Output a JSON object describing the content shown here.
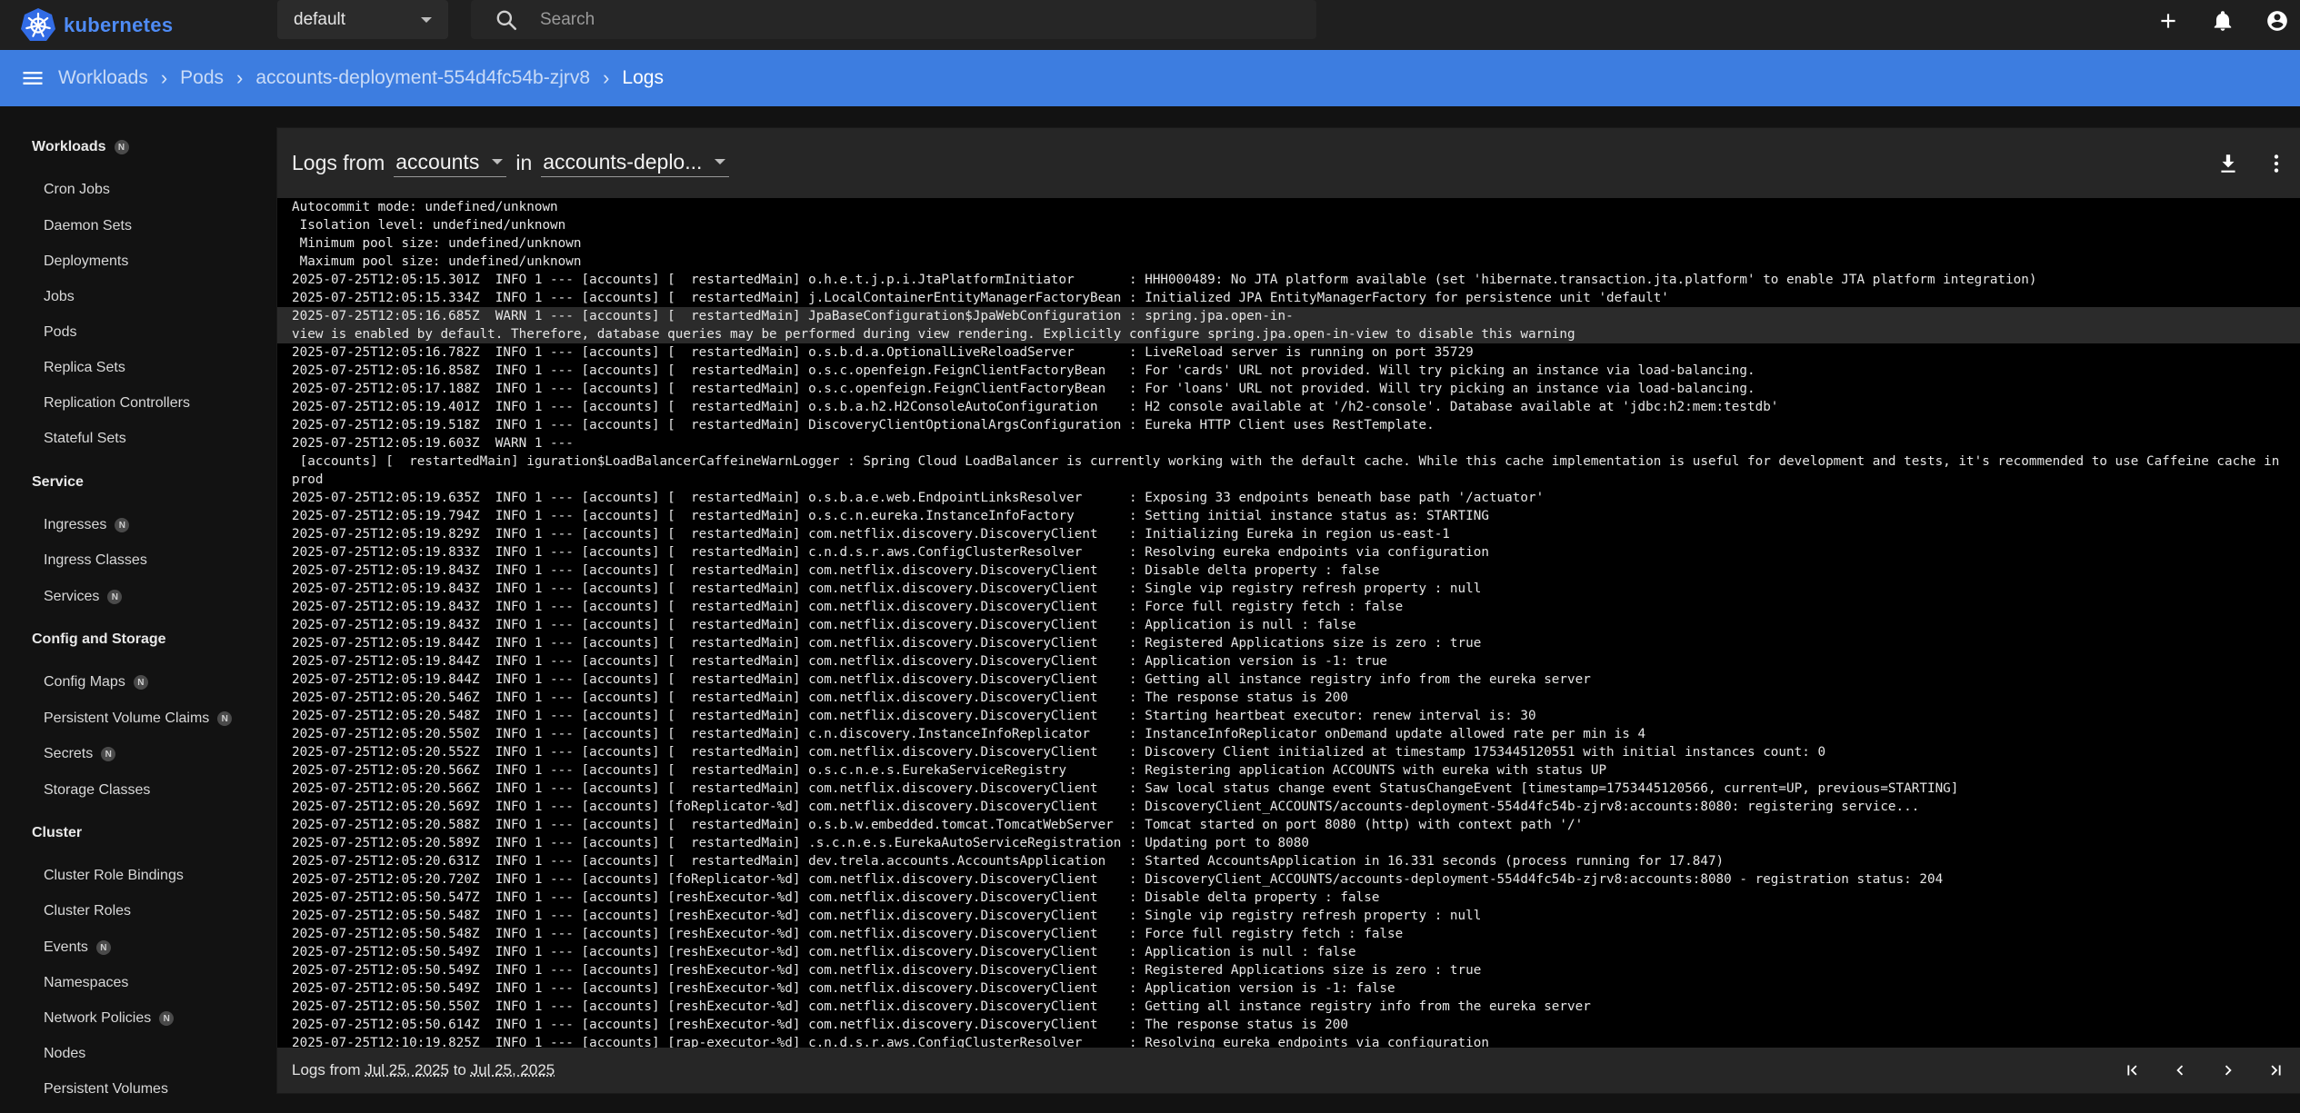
{
  "app": {
    "brand": "kubernetes"
  },
  "topbar": {
    "namespace": "default",
    "search_placeholder": "Search"
  },
  "breadcrumb": [
    {
      "label": "Workloads",
      "current": false
    },
    {
      "label": "Pods",
      "current": false
    },
    {
      "label": "accounts-deployment-554d4fc54b-zjrv8",
      "current": false
    },
    {
      "label": "Logs",
      "current": true
    }
  ],
  "sidebar": {
    "sections": [
      {
        "title": "Workloads",
        "badge": "N",
        "items": [
          {
            "label": "Cron Jobs"
          },
          {
            "label": "Daemon Sets"
          },
          {
            "label": "Deployments"
          },
          {
            "label": "Jobs"
          },
          {
            "label": "Pods"
          },
          {
            "label": "Replica Sets"
          },
          {
            "label": "Replication Controllers"
          },
          {
            "label": "Stateful Sets"
          }
        ]
      },
      {
        "title": "Service",
        "items": [
          {
            "label": "Ingresses",
            "badge": "N"
          },
          {
            "label": "Ingress Classes"
          },
          {
            "label": "Services",
            "badge": "N"
          }
        ]
      },
      {
        "title": "Config and Storage",
        "items": [
          {
            "label": "Config Maps",
            "badge": "N"
          },
          {
            "label": "Persistent Volume Claims",
            "badge": "N"
          },
          {
            "label": "Secrets",
            "badge": "N"
          },
          {
            "label": "Storage Classes"
          }
        ]
      },
      {
        "title": "Cluster",
        "items": [
          {
            "label": "Cluster Role Bindings"
          },
          {
            "label": "Cluster Roles"
          },
          {
            "label": "Events",
            "badge": "N"
          },
          {
            "label": "Namespaces"
          },
          {
            "label": "Network Policies",
            "badge": "N"
          },
          {
            "label": "Nodes"
          },
          {
            "label": "Persistent Volumes"
          }
        ]
      }
    ]
  },
  "logs": {
    "header": {
      "prefix": "Logs from",
      "container": "accounts",
      "middle": "in",
      "pod": "accounts-deplo..."
    },
    "lines": [
      {
        "text": "Autocommit mode: undefined/unknown"
      },
      {
        "text": " Isolation level: undefined/unknown"
      },
      {
        "text": " Minimum pool size: undefined/unknown"
      },
      {
        "text": " Maximum pool size: undefined/unknown"
      },
      {
        "text": "2025-07-25T12:05:15.301Z  INFO 1 --- [accounts] [  restartedMain] o.h.e.t.j.p.i.JtaPlatformInitiator       : HHH000489: No JTA platform available (set 'hibernate.transaction.jta.platform' to enable JTA platform integration)"
      },
      {
        "text": "2025-07-25T12:05:15.334Z  INFO 1 --- [accounts] [  restartedMain] j.LocalContainerEntityManagerFactoryBean : Initialized JPA EntityManagerFactory for persistence unit 'default'"
      },
      {
        "text": "2025-07-25T12:05:16.685Z  WARN 1 --- [accounts] [  restartedMain] JpaBaseConfiguration$JpaWebConfiguration : spring.jpa.open-in-\nview is enabled by default. Therefore, database queries may be performed during view rendering. Explicitly configure spring.jpa.open-in-view to disable this warning",
        "highlight": true,
        "wrap": true
      },
      {
        "text": "2025-07-25T12:05:16.782Z  INFO 1 --- [accounts] [  restartedMain] o.s.b.d.a.OptionalLiveReloadServer       : LiveReload server is running on port 35729"
      },
      {
        "text": "2025-07-25T12:05:16.858Z  INFO 1 --- [accounts] [  restartedMain] o.s.c.openfeign.FeignClientFactoryBean   : For 'cards' URL not provided. Will try picking an instance via load-balancing."
      },
      {
        "text": "2025-07-25T12:05:17.188Z  INFO 1 --- [accounts] [  restartedMain] o.s.c.openfeign.FeignClientFactoryBean   : For 'loans' URL not provided. Will try picking an instance via load-balancing."
      },
      {
        "text": "2025-07-25T12:05:19.401Z  INFO 1 --- [accounts] [  restartedMain] o.s.b.a.h2.H2ConsoleAutoConfiguration    : H2 console available at '/h2-console'. Database available at 'jdbc:h2:mem:testdb'"
      },
      {
        "text": "2025-07-25T12:05:19.518Z  INFO 1 --- [accounts] [  restartedMain] DiscoveryClientOptionalArgsConfiguration : Eureka HTTP Client uses RestTemplate."
      },
      {
        "text": "2025-07-25T12:05:19.603Z  WARN 1 ---"
      },
      {
        "text": " [accounts] [  restartedMain] iguration$LoadBalancerCaffeineWarnLogger : Spring Cloud LoadBalancer is currently working with the default cache. While this cache implementation is useful for development and tests, it's recommended to use Caffeine cache in prod\nuction.You can switch to using Caffeine cache, by adding it and org.springframework.cache.caffeine.CaffeineCacheManager to the classpath.",
        "wrap": true
      },
      {
        "text": "2025-07-25T12:05:19.635Z  INFO 1 --- [accounts] [  restartedMain] o.s.b.a.e.web.EndpointLinksResolver      : Exposing 33 endpoints beneath base path '/actuator'"
      },
      {
        "text": "2025-07-25T12:05:19.794Z  INFO 1 --- [accounts] [  restartedMain] o.s.c.n.eureka.InstanceInfoFactory       : Setting initial instance status as: STARTING"
      },
      {
        "text": "2025-07-25T12:05:19.829Z  INFO 1 --- [accounts] [  restartedMain] com.netflix.discovery.DiscoveryClient    : Initializing Eureka in region us-east-1"
      },
      {
        "text": "2025-07-25T12:05:19.833Z  INFO 1 --- [accounts] [  restartedMain] c.n.d.s.r.aws.ConfigClusterResolver      : Resolving eureka endpoints via configuration"
      },
      {
        "text": "2025-07-25T12:05:19.843Z  INFO 1 --- [accounts] [  restartedMain] com.netflix.discovery.DiscoveryClient    : Disable delta property : false"
      },
      {
        "text": "2025-07-25T12:05:19.843Z  INFO 1 --- [accounts] [  restartedMain] com.netflix.discovery.DiscoveryClient    : Single vip registry refresh property : null"
      },
      {
        "text": "2025-07-25T12:05:19.843Z  INFO 1 --- [accounts] [  restartedMain] com.netflix.discovery.DiscoveryClient    : Force full registry fetch : false"
      },
      {
        "text": "2025-07-25T12:05:19.843Z  INFO 1 --- [accounts] [  restartedMain] com.netflix.discovery.DiscoveryClient    : Application is null : false"
      },
      {
        "text": "2025-07-25T12:05:19.844Z  INFO 1 --- [accounts] [  restartedMain] com.netflix.discovery.DiscoveryClient    : Registered Applications size is zero : true"
      },
      {
        "text": "2025-07-25T12:05:19.844Z  INFO 1 --- [accounts] [  restartedMain] com.netflix.discovery.DiscoveryClient    : Application version is -1: true"
      },
      {
        "text": "2025-07-25T12:05:19.844Z  INFO 1 --- [accounts] [  restartedMain] com.netflix.discovery.DiscoveryClient    : Getting all instance registry info from the eureka server"
      },
      {
        "text": "2025-07-25T12:05:20.546Z  INFO 1 --- [accounts] [  restartedMain] com.netflix.discovery.DiscoveryClient    : The response status is 200"
      },
      {
        "text": "2025-07-25T12:05:20.548Z  INFO 1 --- [accounts] [  restartedMain] com.netflix.discovery.DiscoveryClient    : Starting heartbeat executor: renew interval is: 30"
      },
      {
        "text": "2025-07-25T12:05:20.550Z  INFO 1 --- [accounts] [  restartedMain] c.n.discovery.InstanceInfoReplicator     : InstanceInfoReplicator onDemand update allowed rate per min is 4"
      },
      {
        "text": "2025-07-25T12:05:20.552Z  INFO 1 --- [accounts] [  restartedMain] com.netflix.discovery.DiscoveryClient    : Discovery Client initialized at timestamp 1753445120551 with initial instances count: 0"
      },
      {
        "text": "2025-07-25T12:05:20.566Z  INFO 1 --- [accounts] [  restartedMain] o.s.c.n.e.s.EurekaServiceRegistry        : Registering application ACCOUNTS with eureka with status UP"
      },
      {
        "text": "2025-07-25T12:05:20.566Z  INFO 1 --- [accounts] [  restartedMain] com.netflix.discovery.DiscoveryClient    : Saw local status change event StatusChangeEvent [timestamp=1753445120566, current=UP, previous=STARTING]"
      },
      {
        "text": "2025-07-25T12:05:20.569Z  INFO 1 --- [accounts] [foReplicator-%d] com.netflix.discovery.DiscoveryClient    : DiscoveryClient_ACCOUNTS/accounts-deployment-554d4fc54b-zjrv8:accounts:8080: registering service..."
      },
      {
        "text": "2025-07-25T12:05:20.588Z  INFO 1 --- [accounts] [  restartedMain] o.s.b.w.embedded.tomcat.TomcatWebServer  : Tomcat started on port 8080 (http) with context path '/'"
      },
      {
        "text": "2025-07-25T12:05:20.589Z  INFO 1 --- [accounts] [  restartedMain] .s.c.n.e.s.EurekaAutoServiceRegistration : Updating port to 8080"
      },
      {
        "text": "2025-07-25T12:05:20.631Z  INFO 1 --- [accounts] [  restartedMain] dev.trela.accounts.AccountsApplication   : Started AccountsApplication in 16.331 seconds (process running for 17.847)"
      },
      {
        "text": "2025-07-25T12:05:20.720Z  INFO 1 --- [accounts] [foReplicator-%d] com.netflix.discovery.DiscoveryClient    : DiscoveryClient_ACCOUNTS/accounts-deployment-554d4fc54b-zjrv8:accounts:8080 - registration status: 204"
      },
      {
        "text": "2025-07-25T12:05:50.547Z  INFO 1 --- [accounts] [reshExecutor-%d] com.netflix.discovery.DiscoveryClient    : Disable delta property : false"
      },
      {
        "text": "2025-07-25T12:05:50.548Z  INFO 1 --- [accounts] [reshExecutor-%d] com.netflix.discovery.DiscoveryClient    : Single vip registry refresh property : null"
      },
      {
        "text": "2025-07-25T12:05:50.548Z  INFO 1 --- [accounts] [reshExecutor-%d] com.netflix.discovery.DiscoveryClient    : Force full registry fetch : false"
      },
      {
        "text": "2025-07-25T12:05:50.549Z  INFO 1 --- [accounts] [reshExecutor-%d] com.netflix.discovery.DiscoveryClient    : Application is null : false"
      },
      {
        "text": "2025-07-25T12:05:50.549Z  INFO 1 --- [accounts] [reshExecutor-%d] com.netflix.discovery.DiscoveryClient    : Registered Applications size is zero : true"
      },
      {
        "text": "2025-07-25T12:05:50.549Z  INFO 1 --- [accounts] [reshExecutor-%d] com.netflix.discovery.DiscoveryClient    : Application version is -1: false"
      },
      {
        "text": "2025-07-25T12:05:50.550Z  INFO 1 --- [accounts] [reshExecutor-%d] com.netflix.discovery.DiscoveryClient    : Getting all instance registry info from the eureka server"
      },
      {
        "text": "2025-07-25T12:05:50.614Z  INFO 1 --- [accounts] [reshExecutor-%d] com.netflix.discovery.DiscoveryClient    : The response status is 200"
      },
      {
        "text": "2025-07-25T12:10:19.825Z  INFO 1 --- [accounts] [rap-executor-%d] c.n.d.s.r.aws.ConfigClusterResolver      : Resolving eureka endpoints via configuration"
      }
    ],
    "footer": {
      "prefix": "Logs from",
      "from": "Jul 25, 2025",
      "to_word": "to",
      "to": "Jul 25, 2025"
    }
  },
  "colors": {
    "accent": "#3d7de0",
    "brand": "#326ce5"
  }
}
